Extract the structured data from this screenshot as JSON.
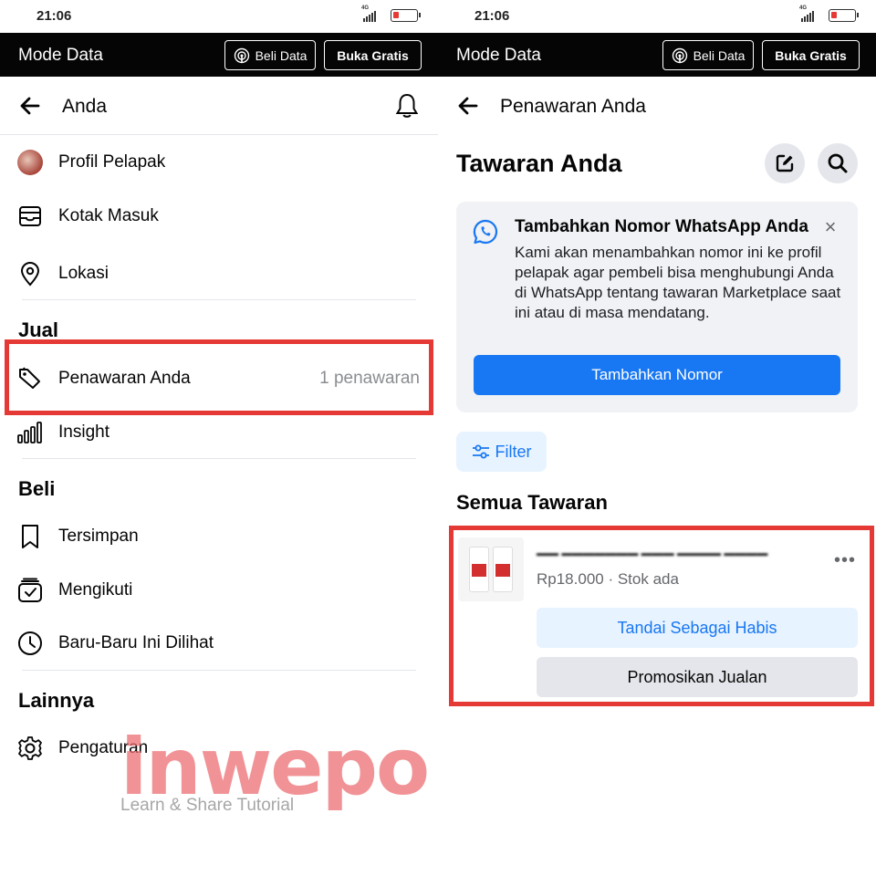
{
  "status_bar": {
    "time": "21:06",
    "network": "4G"
  },
  "data_bar": {
    "title": "Mode Data",
    "beli_label": "Beli Data",
    "buka_label": "Buka Gratis"
  },
  "left": {
    "header_title": "Anda",
    "items_top": [
      {
        "label": "Profil Pelapak",
        "icon": "avatar"
      },
      {
        "label": "Kotak Masuk",
        "icon": "inbox-icon"
      },
      {
        "label": "Lokasi",
        "icon": "location-pin-icon"
      }
    ],
    "section_jual": "Jual",
    "jual_items": [
      {
        "label": "Penawaran Anda",
        "right": "1 penawaran",
        "icon": "tag-icon"
      },
      {
        "label": "Insight",
        "icon": "bar-chart-icon"
      }
    ],
    "section_beli": "Beli",
    "beli_items": [
      {
        "label": "Tersimpan",
        "icon": "bookmark-icon"
      },
      {
        "label": "Mengikuti",
        "icon": "following-icon"
      },
      {
        "label": "Baru-Baru Ini Dilihat",
        "icon": "clock-icon"
      }
    ],
    "section_lainnya": "Lainnya",
    "lainnya_items": [
      {
        "label": "Pengaturan",
        "icon": "gear-icon"
      }
    ]
  },
  "watermark": {
    "big": "inwepo",
    "small": "Learn & Share Tutorial"
  },
  "right": {
    "header_title": "Penawaran Anda",
    "page_title": "Tawaran Anda",
    "whatsapp_card": {
      "title": "Tambahkan Nomor WhatsApp Anda",
      "description": "Kami akan menambahkan nomor ini ke profil pelapak agar pembeli bisa menghubungi Anda di WhatsApp tentang tawaran Marketplace saat ini atau di masa mendatang.",
      "button": "Tambahkan Nomor"
    },
    "filter_label": "Filter",
    "section_title": "Semua Tawaran",
    "listing": {
      "price_stock": "Rp18.000 · Stok ada",
      "mark_sold": "Tandai Sebagai Habis",
      "promote": "Promosikan Jualan"
    }
  },
  "colors": {
    "accent": "#1877f2",
    "highlight": "#e53935",
    "databar": "#050505"
  }
}
